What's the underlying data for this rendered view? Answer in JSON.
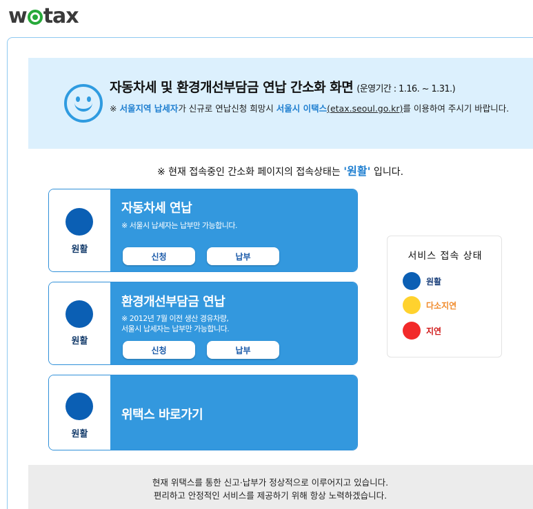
{
  "logo": {
    "pre": "w",
    "post": "tax"
  },
  "notice": {
    "title": "자동차세 및 환경개선부담금 연납 간소화 화면",
    "period": "(운영기간 : 1.16. ~ 1.31.)",
    "body_prefix": "※ ",
    "body_region": "서울지역 납세자",
    "body_mid": "가 신규로 연납신청 희망시 ",
    "body_site": "서울시 이택스",
    "body_url": "(etax.seoul.go.kr)",
    "body_suffix": "를 이용하여 주시기 바랍니다."
  },
  "status_line": {
    "prefix": "※ 현재 접속중인 간소화 페이지의 접속상태는 ",
    "state": "'원활'",
    "suffix": " 입니다."
  },
  "cards": [
    {
      "state": "원활",
      "title": "자동차세 연납",
      "sub_lines": [
        "※ 서울시 납세자는 납부만 가능합니다."
      ],
      "apply_label": "신청",
      "pay_label": "납부"
    },
    {
      "state": "원활",
      "title": "환경개선부담금 연납",
      "sub_lines": [
        "※ 2012년 7월 이전 생산 경유차량,",
        "서울시 납세자는 납부만 가능합니다."
      ],
      "apply_label": "신청",
      "pay_label": "납부"
    },
    {
      "state": "원활",
      "title": "위택스 바로가기"
    }
  ],
  "legend": {
    "title": "서비스 접속 상태",
    "items": [
      {
        "label": "원활",
        "color": "#0b5fb4",
        "text_color": "#1a3f7a"
      },
      {
        "label": "다소지연",
        "color": "#ffd22e",
        "text_color": "#f08a2a"
      },
      {
        "label": "지연",
        "color": "#f22a2a",
        "text_color": "#d01818"
      }
    ]
  },
  "footer": {
    "line1": "현재 위택스를 통한 신고·납부가 정상적으로 이루어지고 있습니다.",
    "line2": "편리하고 안정적인 서비스를 제공하기 위해 항상 노력하겠습니다."
  },
  "colors": {
    "accent": "#3398de",
    "status_ok": "#0b5fb4",
    "banner_bg": "#dcf0fd"
  }
}
